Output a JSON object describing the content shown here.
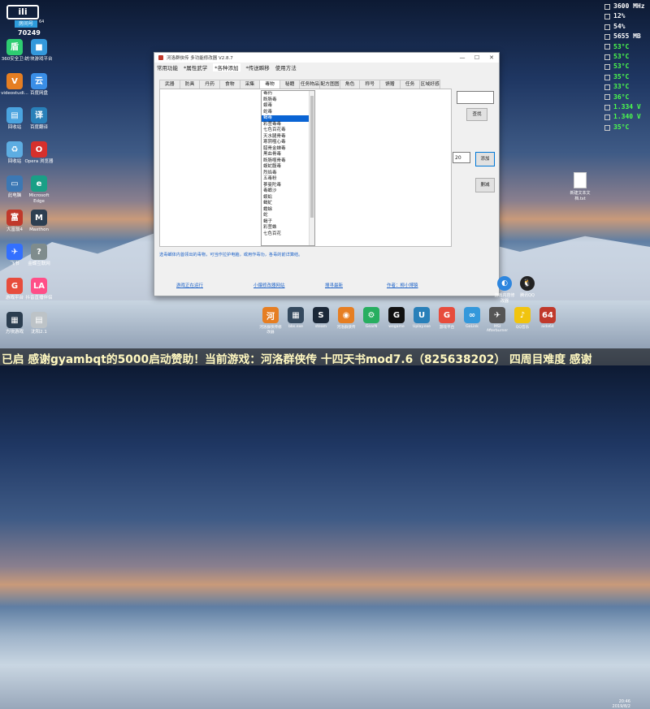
{
  "stream": {
    "logo": "ili",
    "room_label": "房间号",
    "room_id": "70249",
    "corner": "64"
  },
  "hud": {
    "rows": [
      {
        "text": "3600 MHz",
        "color": "#ffffff"
      },
      {
        "text": "12%",
        "color": "#ffffff"
      },
      {
        "text": "54%",
        "color": "#ffffff"
      },
      {
        "text": "5655 MB",
        "color": "#ffffff"
      },
      {
        "text": "53°C",
        "color": "#4cff4c"
      },
      {
        "text": "53°C",
        "color": "#4cff4c"
      },
      {
        "text": "53°C",
        "color": "#4cff4c"
      },
      {
        "text": "35°C",
        "color": "#4cff4c"
      },
      {
        "text": "33°C",
        "color": "#4cff4c"
      },
      {
        "text": "36°C",
        "color": "#4cff4c"
      },
      {
        "text": "1.334 V",
        "color": "#4cff4c"
      },
      {
        "text": "1.340 V",
        "color": "#4cff4c"
      },
      {
        "text": "35°C",
        "color": "#4cff4c"
      }
    ]
  },
  "desktop": {
    "left_icons": [
      {
        "label": "360安全卫士",
        "icon": "shield-icon",
        "color": "#2ecc71",
        "glyph": "盾"
      },
      {
        "label": "方块游戏平台",
        "icon": "cube-icon",
        "color": "#3498db",
        "glyph": "■"
      },
      {
        "label": "videostudi...",
        "icon": "video-icon",
        "color": "#e67e22",
        "glyph": "V"
      },
      {
        "label": "百度网盘",
        "icon": "cloud-icon",
        "color": "#3a8ee6",
        "glyph": "云"
      },
      {
        "label": "回收站",
        "icon": "folder-icon",
        "color": "#4aa3df",
        "glyph": "▤"
      },
      {
        "label": "百度翻译",
        "icon": "translate-icon",
        "color": "#2980b9",
        "glyph": "译"
      },
      {
        "label": "回收站",
        "icon": "recycle-bin-icon",
        "color": "#5dade2",
        "glyph": "♻"
      },
      {
        "label": "Opera 浏览器",
        "icon": "opera-icon",
        "color": "#d6302c",
        "glyph": "O"
      },
      {
        "label": "此电脑",
        "icon": "computer-icon",
        "color": "#3c78b4",
        "glyph": "▭"
      },
      {
        "label": "Microsoft Edge",
        "icon": "edge-icon",
        "color": "#1a9f86",
        "glyph": "e"
      },
      {
        "label": "大富翁4",
        "icon": "game-icon",
        "color": "#c0392b",
        "glyph": "富"
      },
      {
        "label": "Maxthon",
        "icon": "maxthon-icon",
        "color": "#2c3e50",
        "glyph": "M"
      },
      {
        "label": "飞书",
        "icon": "feishu-icon",
        "color": "#3370ff",
        "glyph": "✈"
      },
      {
        "label": "金蝶互联网",
        "icon": "kingdee-icon",
        "color": "#7f8c8d",
        "glyph": "?"
      },
      {
        "label": "游戏平台",
        "icon": "game-platform-icon",
        "color": "#e74c3c",
        "glyph": "G"
      },
      {
        "label": "抖音直播伴侣",
        "icon": "douyin-icon",
        "color": "#ff4f88",
        "glyph": "LA"
      },
      {
        "label": "方块游戏",
        "icon": "block-icon",
        "color": "#2c3e50",
        "glyph": "▦"
      },
      {
        "label": "沈阳2.1",
        "icon": "document-icon",
        "color": "#bdc3c7",
        "glyph": "▤"
      }
    ],
    "right_file": "新建文本文档.txt"
  },
  "window": {
    "title": "河洛群侠传 多功能修改器 V2.8.7",
    "controls": [
      "—",
      "☐",
      "✕"
    ],
    "menu": [
      "常用功能",
      "*属性武学",
      "*各种添加",
      "*传送瞬移",
      "使用方法"
    ],
    "tabs": [
      "武器",
      "防具",
      "丹药",
      "食物",
      "采集",
      "毒物",
      "秘籍",
      "任务物品",
      "配方图图",
      "角色",
      "称号",
      "馈赠",
      "任务",
      "区域好感"
    ],
    "active_tab": 5,
    "list_items": [
      "毒药",
      "断肠毒",
      "蜈毒",
      "蛇毒",
      "蝎毒",
      "彩萱毒毒",
      "七色百花毒",
      "天水腿骨毒",
      "寒阴噬心毒",
      "腊骨金蝉毒",
      "黑血骨毒",
      "断肠噬骨毒",
      "蝮蛇腹毒",
      "烈焰毒",
      "五毒粉",
      "蔘曼陀毒",
      "毒螂沙",
      "蜈蚣",
      "蝎虻",
      "蟾蜍",
      "蛇",
      "蝎子",
      "彩萱蛛",
      "七色百花"
    ],
    "selected_item": 4,
    "find_button": "查找",
    "qty_value": "20",
    "add_button": "添加",
    "delete_button": "删减",
    "hint": "选毒螂体内首领出的毒物，可当作拉护电脑，或用作毒功，各毒的前详算结。",
    "footer": [
      "游戏正在运行",
      "小爆修改器网站",
      "搜寻最新",
      "作者：柳小博猿"
    ]
  },
  "tray": [
    {
      "label": "游戏内容修改器",
      "icon": "modifier-icon",
      "color": "#2e86de",
      "glyph": "◐"
    },
    {
      "label": "腾讯QQ",
      "icon": "qq-icon",
      "color": "#222",
      "glyph": "🐧"
    }
  ],
  "taskbar": [
    {
      "label": "河洛群侠传修改器",
      "icon": "app-icon",
      "color": "#e67e22",
      "glyph": "河"
    },
    {
      "label": "bbs.exe",
      "icon": "grid-icon",
      "color": "#34495e",
      "glyph": "▦"
    },
    {
      "label": "steam",
      "icon": "steam-icon",
      "color": "#1b2838",
      "glyph": "S"
    },
    {
      "label": "河洛群侠传",
      "icon": "fox-icon",
      "color": "#e67e22",
      "glyph": "◉"
    },
    {
      "label": "GearN",
      "icon": "gear-icon",
      "color": "#27ae60",
      "glyph": "⚙"
    },
    {
      "label": "wegame",
      "icon": "wegame-icon",
      "color": "#111",
      "glyph": "G"
    },
    {
      "label": "Uplay.exe",
      "icon": "uplay-icon",
      "color": "#2980b9",
      "glyph": "U"
    },
    {
      "label": "游戏平台",
      "icon": "game-platform-icon",
      "color": "#e74c3c",
      "glyph": "G"
    },
    {
      "label": "GoLink",
      "icon": "golink-icon",
      "color": "#3498db",
      "glyph": "∞"
    },
    {
      "label": "MSI Afterburner",
      "icon": "msi-icon",
      "color": "#555",
      "glyph": "✈"
    },
    {
      "label": "QQ音乐",
      "icon": "music-icon",
      "color": "#f1c40f",
      "glyph": "♪"
    },
    {
      "label": "aida64",
      "icon": "aida-icon",
      "color": "#c0392b",
      "glyph": "64"
    }
  ],
  "danmu": "已启 感谢gyambqt的5000启动赞助！当前游戏：河洛群侠传 十四天书mod7.6（825638202） 四周目难度 感谢",
  "clock": {
    "time": "20:46",
    "date": "2019/8/2"
  }
}
